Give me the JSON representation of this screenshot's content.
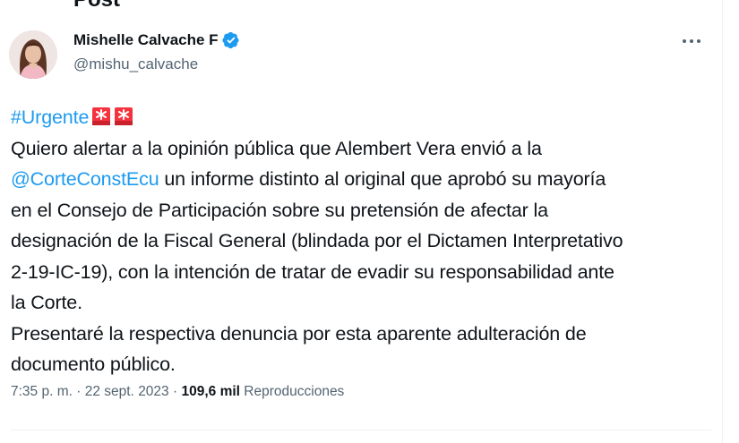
{
  "header": {
    "title": "Post"
  },
  "author": {
    "name": "Mishelle Calvache F",
    "handle": "@mishu_calvache"
  },
  "tweet": {
    "hashtag": "#Urgente",
    "lines": [
      "Quiero alertar a la opinión pública que Alembert Vera envió a la",
      "un informe distinto al original que aprobó su mayoría",
      "en el Consejo de Participación sobre su pretensión de afectar la",
      "designación de la Fiscal General (blindada por el Dictamen Interpretativo",
      "2-19-IC-19), con la intención de tratar de evadir su responsabilidad ante",
      "la Corte.",
      "Presentaré la respectiva denuncia  por esta aparente adulteración de",
      "documento público."
    ],
    "mention": "@CorteConstEcu"
  },
  "meta": {
    "time": "7:35 p. m.",
    "separator": "·",
    "date": "22 sept. 2023",
    "views_count": "109,6 mil",
    "views_label": "Reproducciones"
  },
  "colors": {
    "link": "#1d9bf0",
    "verified": "#1d9bf0",
    "secondary_text": "#536471",
    "siren": "#f4333f"
  },
  "icons": [
    "verified-badge-icon",
    "more-options-icon",
    "siren-emoji-icon"
  ]
}
